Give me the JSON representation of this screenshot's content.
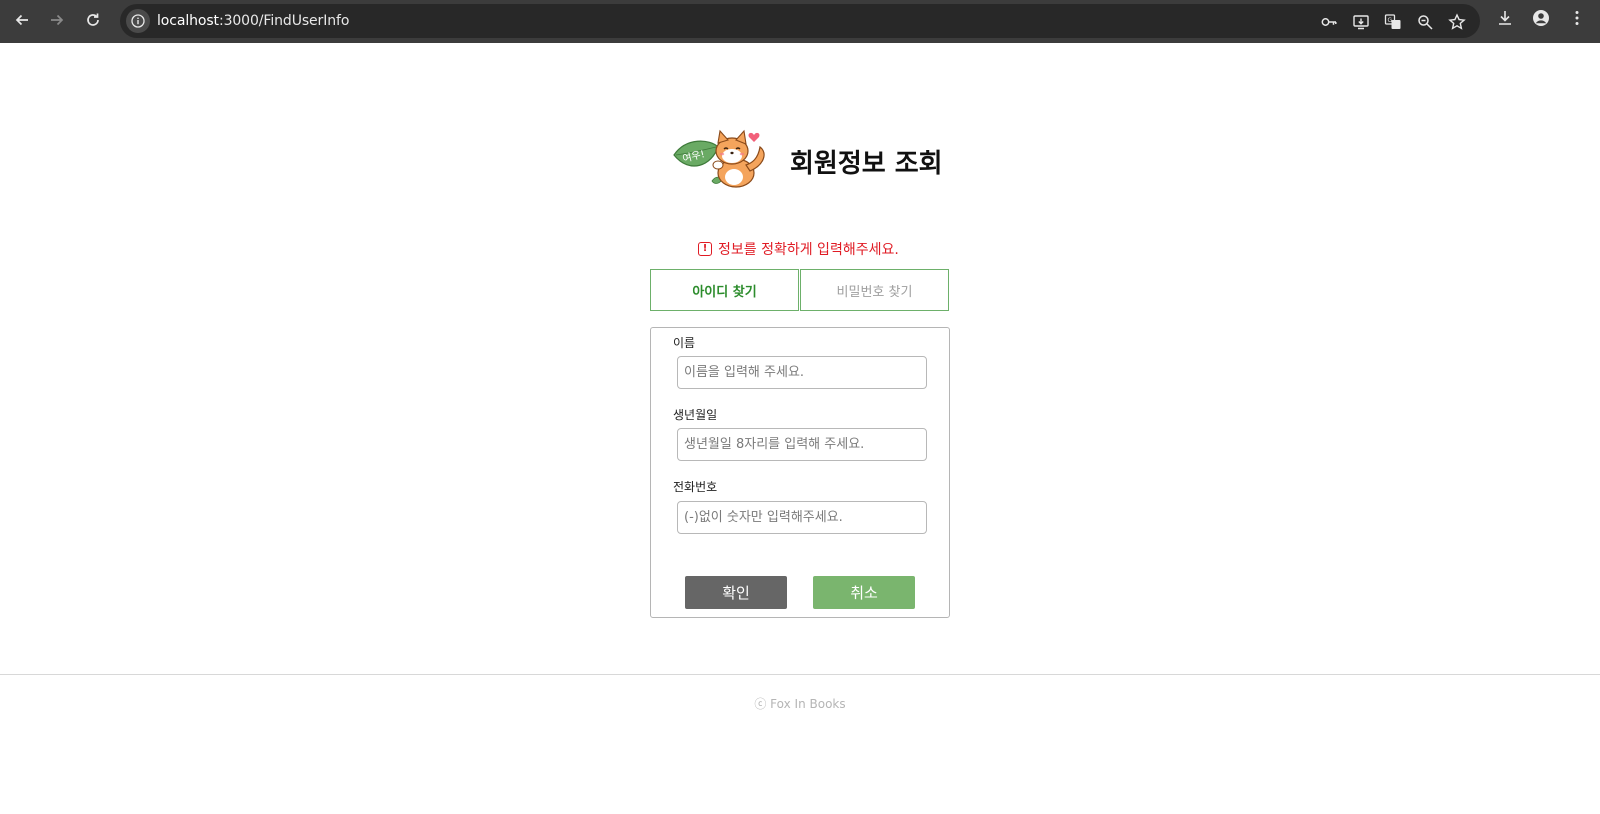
{
  "browser": {
    "url_host": "localhost",
    "url_path": ":3000/FindUserInfo",
    "icons": [
      "back-icon",
      "forward-icon",
      "reload-icon",
      "site-info-icon",
      "password-key-icon",
      "install-app-icon",
      "translate-icon",
      "zoom-icon",
      "bookmark-star-icon",
      "download-icon",
      "profile-icon",
      "menu-icon"
    ]
  },
  "header": {
    "title": "회원정보 조회",
    "logo_text": "여우!"
  },
  "alert": {
    "icon": "!",
    "message": "정보를 정확하게 입력해주세요."
  },
  "tabs": {
    "find_id": "아이디 찾기",
    "find_pw": "비밀번호 찾기"
  },
  "form": {
    "name_label": "이름",
    "name_placeholder": "이름을 입력해 주세요.",
    "birth_label": "생년월일",
    "birth_placeholder": "생년월일 8자리를 입력해 주세요.",
    "phone_label": "전화번호",
    "phone_placeholder": "(-)없이 숫자만 입력해주세요.",
    "confirm_label": "확인",
    "cancel_label": "취소"
  },
  "footer": {
    "text": "ⓒ Fox In Books"
  },
  "colors": {
    "accent_green": "#7ab56e",
    "tab_text_green": "#2c8c2c",
    "alert_red": "#e01b24",
    "confirm_gray": "#666666"
  }
}
